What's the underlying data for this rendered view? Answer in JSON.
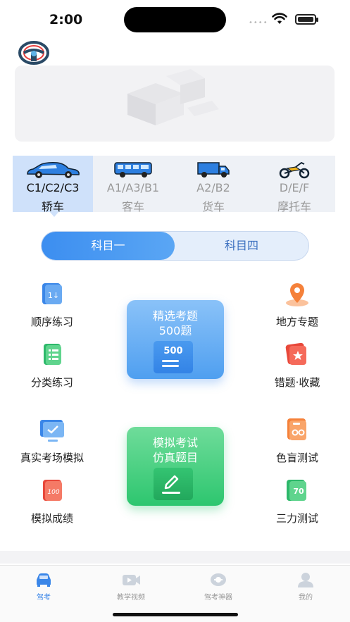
{
  "status": {
    "time": "2:00"
  },
  "vehicles": [
    {
      "code": "C1/C2/C3",
      "name": "轿车",
      "selected": true,
      "icon": "car-icon"
    },
    {
      "code": "A1/A3/B1",
      "name": "客车",
      "selected": false,
      "icon": "bus-icon"
    },
    {
      "code": "A2/B2",
      "name": "货车",
      "selected": false,
      "icon": "truck-icon"
    },
    {
      "code": "D/E/F",
      "name": "摩托车",
      "selected": false,
      "icon": "motorcycle-icon"
    }
  ],
  "subjects": {
    "first": "科目一",
    "fourth": "科目四",
    "active": "科目一"
  },
  "features": {
    "sequence": "顺序练习",
    "category": "分类练习",
    "exam_sim": "真实考场模拟",
    "sim_scores": "模拟成绩",
    "local": "地方专题",
    "mistakes": "错题·收藏",
    "color_blind": "色盲测试",
    "three_force": "三力测试"
  },
  "cards": {
    "selected": {
      "line1": "精选考题",
      "line2": "500题",
      "badge": "500"
    },
    "mock": {
      "line1": "模拟考试",
      "line2": "仿真题目"
    }
  },
  "tabs": [
    {
      "label": "驾考",
      "active": true,
      "icon": "car-tab-icon"
    },
    {
      "label": "教学视频",
      "active": false,
      "icon": "video-tab-icon"
    },
    {
      "label": "驾考神器",
      "active": false,
      "icon": "tool-tab-icon"
    },
    {
      "label": "我的",
      "active": false,
      "icon": "profile-tab-icon"
    }
  ],
  "colors": {
    "accent": "#3a86e8",
    "selected_bg": "#cfe1fa",
    "green": "#2dc66f"
  }
}
